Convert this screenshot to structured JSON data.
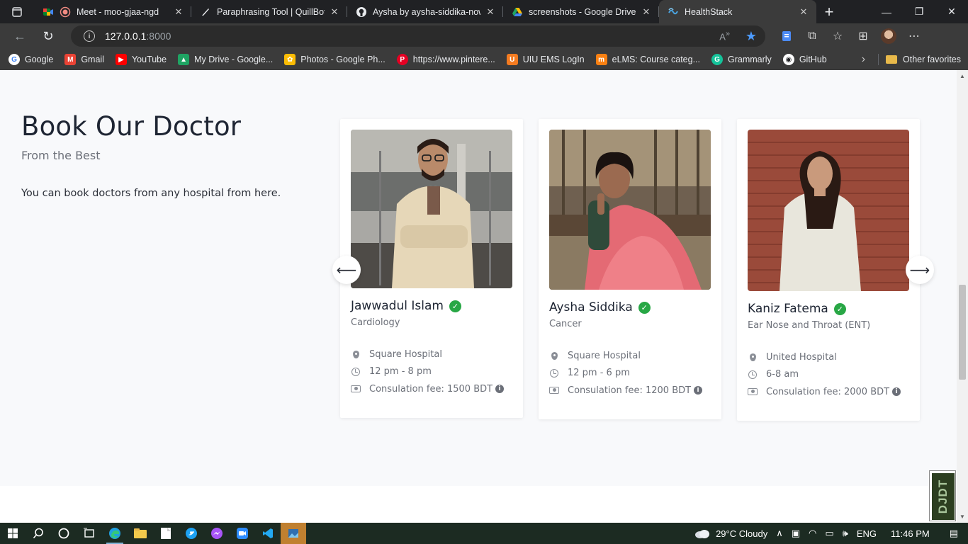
{
  "browser": {
    "tabs": [
      {
        "title": "Meet - moo-gjaa-ngd",
        "favicon": "meet-icon",
        "active": false
      },
      {
        "title": "Paraphrasing Tool | QuillBot AI",
        "favicon": "quillbot-icon",
        "active": false
      },
      {
        "title": "Aysha by aysha-siddika-nowshin",
        "favicon": "github-icon",
        "active": false
      },
      {
        "title": "screenshots - Google Drive",
        "favicon": "drive-icon",
        "active": false
      },
      {
        "title": "HealthStack",
        "favicon": "healthstack-icon",
        "active": true
      }
    ],
    "url_host": "127.0.0.1",
    "url_port": ":8000",
    "bookmarks": [
      {
        "label": "Google",
        "icon": "google-icon",
        "color": "#4285f4"
      },
      {
        "label": "Gmail",
        "icon": "gmail-icon",
        "color": "#ea4335"
      },
      {
        "label": "YouTube",
        "icon": "youtube-icon",
        "color": "#ff0000"
      },
      {
        "label": "My Drive - Google...",
        "icon": "drive-icon",
        "color": "#1fa463"
      },
      {
        "label": "Photos - Google Ph...",
        "icon": "photos-icon",
        "color": "#fbbc05"
      },
      {
        "label": "https://www.pintere...",
        "icon": "pinterest-icon",
        "color": "#e60023"
      },
      {
        "label": "UIU EMS LogIn",
        "icon": "uiu-icon",
        "color": "#f47b20"
      },
      {
        "label": "eLMS: Course categ...",
        "icon": "elms-icon",
        "color": "#f98012"
      },
      {
        "label": "Grammarly",
        "icon": "grammarly-icon",
        "color": "#15c39a"
      },
      {
        "label": "GitHub",
        "icon": "github-icon",
        "color": "#ffffff"
      }
    ],
    "other_favorites": "Other favorites"
  },
  "section": {
    "title": "Book Our Doctor",
    "subtitle": "From the Best",
    "description": "You can book doctors from any hospital from here."
  },
  "doctors": [
    {
      "name": "Jawwadul Islam",
      "specialty": "Cardiology",
      "hospital": "Square Hospital",
      "hours": "12 pm - 8 pm",
      "fee": "Consulation fee: 1500 BDT"
    },
    {
      "name": "Aysha Siddika",
      "specialty": "Cancer",
      "hospital": "Square Hospital",
      "hours": "12 pm - 6 pm",
      "fee": "Consulation fee: 1200 BDT"
    },
    {
      "name": "Kaniz Fatema",
      "specialty": "Ear Nose and Throat (ENT)",
      "hospital": "United Hospital",
      "hours": "6-8 am",
      "fee": "Consulation fee: 2000 BDT"
    }
  ],
  "carousel": {
    "prev_icon": "arrow-left-icon",
    "next_icon": "arrow-right-icon"
  },
  "debug_toolbar": {
    "label": "DJDT"
  },
  "taskbar": {
    "weather": "29°C  Cloudy",
    "language": "ENG",
    "time": "11:46 PM"
  },
  "colors": {
    "verified": "#28a745",
    "page_bg": "#f8f9fb",
    "heading": "#1e2533"
  }
}
